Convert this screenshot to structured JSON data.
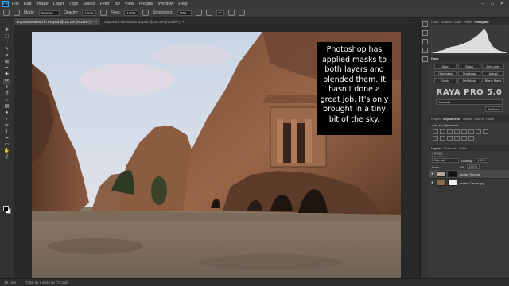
{
  "menubar": {
    "items": [
      "File",
      "Edit",
      "Image",
      "Layer",
      "Type",
      "Select",
      "Filter",
      "3D",
      "View",
      "Plugins",
      "Window",
      "Help"
    ],
    "logo": "Ps"
  },
  "options": {
    "mode_label": "Mode:",
    "mode_value": "Normal",
    "opacity_label": "Opacity:",
    "opacity_value": "100%",
    "flow_label": "Flow:",
    "flow_value": "100%",
    "smoothing_label": "Smoothing:",
    "smoothing_value": "10%",
    "angle_value": "0°"
  },
  "tabs": [
    {
      "label": "Exposure Blend in PS.psd @ 18.1% (RGB/8*) *"
    },
    {
      "label": "Exposure Blend with ID.psd @ 18.1% (RGB/8*)"
    }
  ],
  "callout": {
    "text": "Photoshop has applied masks to both layers and blended them. It hasn't done a great job. It's only brought in a tiny bit of the sky."
  },
  "status": {
    "zoom": "18.14%",
    "doc_size": "7360 px x 4912 px (72 ppi)"
  },
  "panels": {
    "top_tabs": [
      "Color",
      "Swatch",
      "Grad",
      "Patter",
      "Histogram"
    ],
    "active_top_tab": "Histogram",
    "raya_tab": "Raya",
    "raya_buttons": [
      "Align",
      "Stack",
      "Del Layer",
      "Highlights",
      "Shadows",
      "Adjust",
      "Undo",
      "Del Mask",
      "Blank Mask"
    ],
    "raya_logo": "RAYA PRO 5.0",
    "raya_select": "Tutorials",
    "raya_small_btn": "Toolshop",
    "mid_tabs": [
      "Proper",
      "Adjustments",
      "Librari",
      "Chann",
      "Paths"
    ],
    "adj_label": "Add an adjustment",
    "layer_tabs": [
      "Layers",
      "Channels",
      "Paths"
    ],
    "kind_label": "Kind",
    "blend_mode": "Normal",
    "opacity_label": "Opacity:",
    "opacity_value": "100%",
    "lock_label": "Lock:",
    "fill_label": "Fill:",
    "fill_value": "100%",
    "layers": [
      {
        "name": "Jordan Sky.jpg"
      },
      {
        "name": "Jordan Canon.jpg"
      }
    ]
  },
  "colors": {
    "accent": "#31a8ff",
    "callout_bg": "#000000"
  }
}
